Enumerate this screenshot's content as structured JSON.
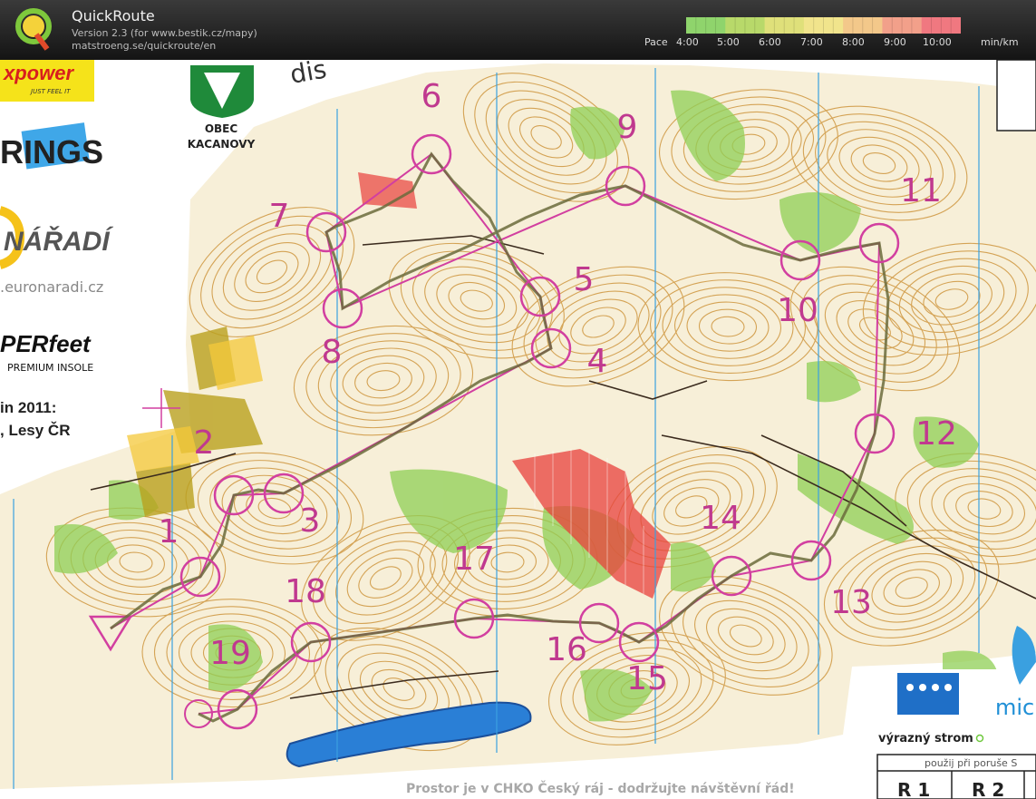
{
  "app": {
    "title": "QuickRoute",
    "version": "Version 2.3  (for www.bestik.cz/mapy)",
    "url": "matstroeng.se/quickroute/en"
  },
  "pace_scale": {
    "label": "Pace",
    "ticks": [
      "4:00",
      "5:00",
      "6:00",
      "7:00",
      "8:00",
      "9:00",
      "10:00"
    ],
    "unit": "min/km",
    "colors": [
      "#8fd46c",
      "#b8d96a",
      "#dfe07a",
      "#f1e48c",
      "#f3c88a",
      "#f2a08a",
      "#f07880"
    ]
  },
  "map": {
    "colors": {
      "background": "#f7efd8",
      "contour": "#c98a2a",
      "course": "#d23fa0",
      "route": "#6b6b3c",
      "forest_green": "#8fcf55",
      "water": "#2a7fd6",
      "forbidden": "#e8403c",
      "magnetic_north": "#3aa0e0"
    },
    "controls": [
      {
        "number": "1"
      },
      {
        "number": "2"
      },
      {
        "number": "3"
      },
      {
        "number": "4"
      },
      {
        "number": "5"
      },
      {
        "number": "6"
      },
      {
        "number": "7"
      },
      {
        "number": "8"
      },
      {
        "number": "9"
      },
      {
        "number": "10"
      },
      {
        "number": "11"
      },
      {
        "number": "12"
      },
      {
        "number": "13"
      },
      {
        "number": "14"
      },
      {
        "number": "15"
      },
      {
        "number": "16"
      },
      {
        "number": "17"
      },
      {
        "number": "18"
      },
      {
        "number": "19"
      }
    ],
    "texts": {
      "obec_line1": "OBEC",
      "obec_line2": "KACANOVY",
      "top_text": "dis",
      "sponsor_xpower": "xpower",
      "sponsor_xpower_tag": "JUST FEEL IT",
      "sponsor_rings": "RINGS",
      "sponsor_naradi": "NÁŘADÍ",
      "sponsor_euronaradi": ".euronaradi.cz",
      "sponsor_perfeet": "PERfeet",
      "sponsor_premium": "PREMIUM INSOLE",
      "partners_line1": "in 2011:",
      "partners_line2": ", Lesy ČR",
      "legend_tree": "výrazný strom",
      "legend_mic": "mic",
      "footer_notice": "Prostor je v CHKO Český ráj - dodržujte návštěvní řád!",
      "box_header": "použij při poruše S",
      "box_r1": "R 1",
      "box_r2": "R 2"
    }
  }
}
